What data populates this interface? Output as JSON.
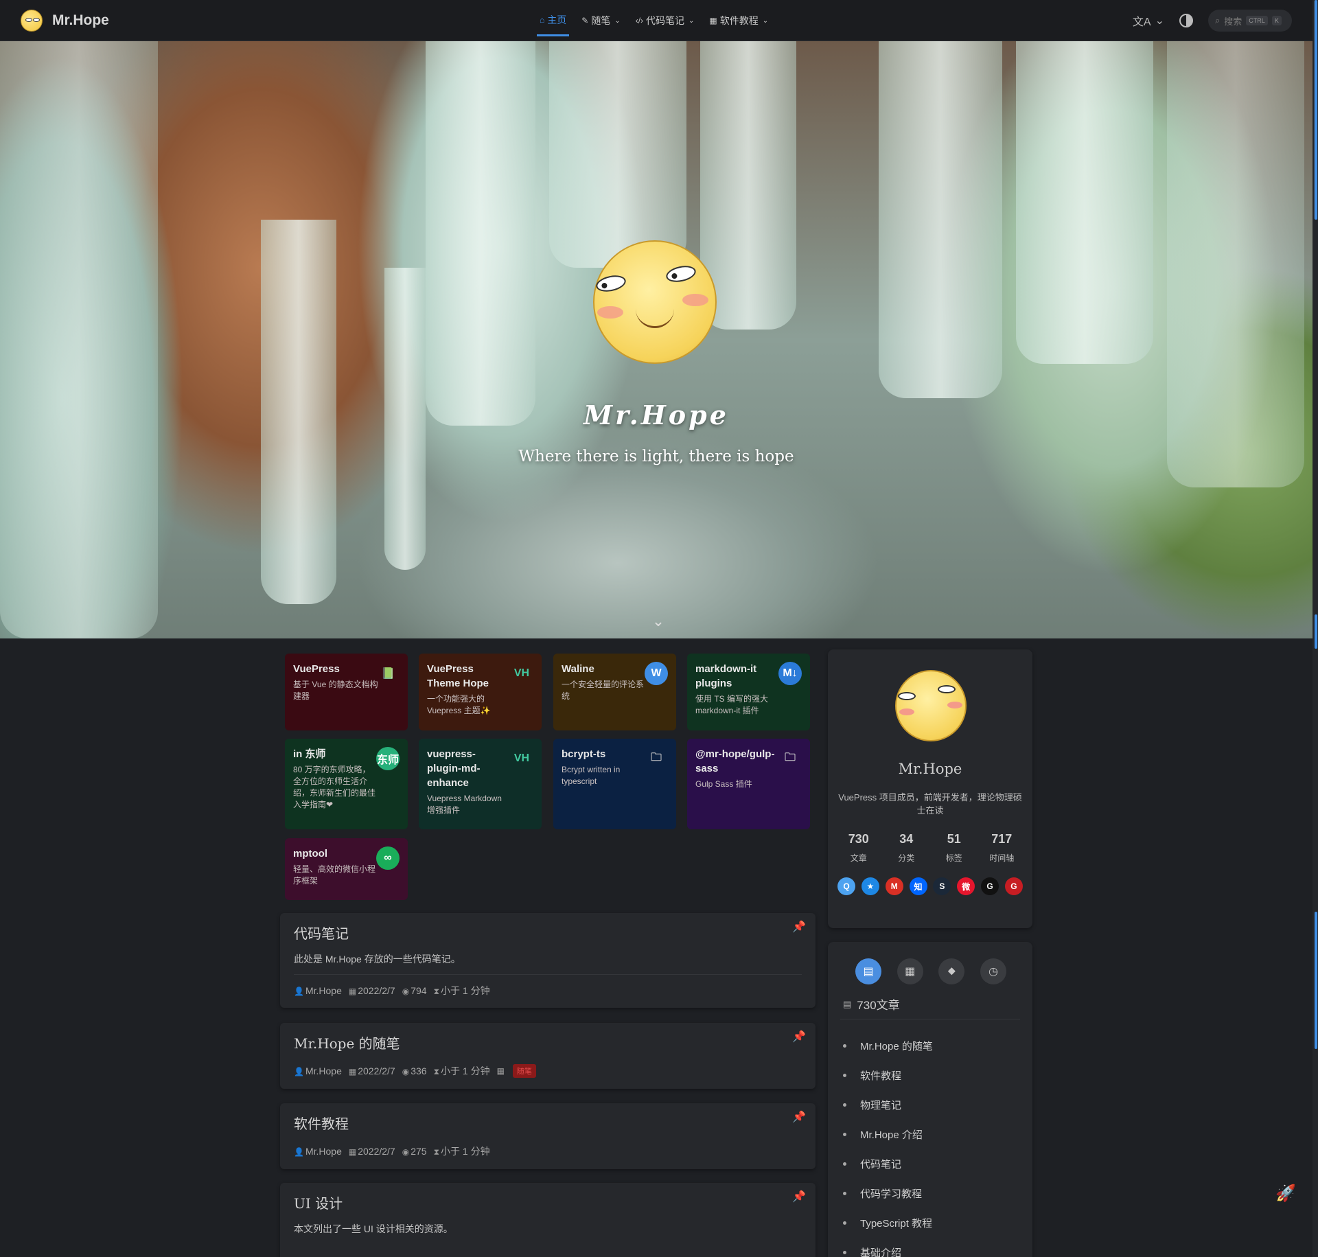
{
  "navbar": {
    "brand": "Mr.Hope",
    "links": [
      {
        "icon": "⌂",
        "label": "主页",
        "active": true,
        "dropdown": false
      },
      {
        "icon": "✎",
        "label": "随笔",
        "active": false,
        "dropdown": true
      },
      {
        "icon": "‹/›",
        "label": "代码笔记",
        "active": false,
        "dropdown": true
      },
      {
        "icon": "▦",
        "label": "软件教程",
        "active": false,
        "dropdown": true
      }
    ],
    "search_placeholder": "搜索",
    "search_key_ctrl": "CTRL",
    "search_key_k": "K"
  },
  "hero": {
    "title": "Mr.Hope",
    "tagline": "Where there is light, there is hope"
  },
  "projects": [
    {
      "name": "VuePress",
      "desc": "基于 Vue 的静态文档构建器",
      "bg": "#3a0a12",
      "icon_name": "vuepress-book-icon",
      "icon_glyph": "📗",
      "icon_bg": "transparent",
      "icon_color": "#4fc08d"
    },
    {
      "name": "VuePress Theme Hope",
      "desc": "一个功能强大的 Vuepress 主题✨",
      "bg": "#3d1a0e",
      "icon_name": "vuepress-theme-hope-icon",
      "icon_glyph": "VH",
      "icon_bg": "transparent",
      "icon_color": "#42c9a0"
    },
    {
      "name": "Waline",
      "desc": "一个安全轻量的评论系统",
      "bg": "#3a280a",
      "icon_name": "waline-icon",
      "icon_glyph": "W",
      "icon_bg": "#3f8ee5",
      "icon_color": "#ffffff"
    },
    {
      "name": "markdown-it plugins",
      "desc": "使用 TS 编写的强大 markdown-it 插件",
      "bg": "#0f3320",
      "icon_name": "markdown-icon",
      "icon_glyph": "M↓",
      "icon_bg": "#2b7bd8",
      "icon_color": "#ffffff"
    },
    {
      "name": "in 东师",
      "desc": "80 万字的东师攻略，全方位的东师生活介绍，东师新生们的最佳入学指南❤",
      "bg": "#0e3320",
      "icon_name": "in-dongshi-icon",
      "icon_glyph": "东师",
      "icon_bg": "#27b07a",
      "icon_color": "#ffffff"
    },
    {
      "name": "vuepress-plugin-md-enhance",
      "desc": "Vuepress Markdown 增强插件",
      "bg": "#0e2e28",
      "icon_name": "vuepress-theme-hope-icon",
      "icon_glyph": "VH",
      "icon_bg": "transparent",
      "icon_color": "#42c9a0"
    },
    {
      "name": "bcrypt-ts",
      "desc": "Bcrypt written in typescript",
      "bg": "#0b2142",
      "icon_name": "folder-icon",
      "icon_glyph": "🗀",
      "icon_bg": "transparent",
      "icon_color": "#cccccc"
    },
    {
      "name": "@mr-hope/gulp-sass",
      "desc": "Gulp Sass 插件",
      "bg": "#2a0f4a",
      "icon_name": "folder-icon",
      "icon_glyph": "🗀",
      "icon_bg": "transparent",
      "icon_color": "#cccccc"
    },
    {
      "name": "mptool",
      "desc": "轻量、高效的微信小程序框架",
      "bg": "#3d0e2c",
      "icon_name": "mini-program-icon",
      "icon_glyph": "∞",
      "icon_bg": "#1aad5a",
      "icon_color": "#ffffff"
    }
  ],
  "articles": [
    {
      "title": "代码笔记",
      "excerpt": "此处是 Mr.Hope 存放的一些代码笔记。",
      "author": "Mr.Hope",
      "date": "2022/2/7",
      "views": "794",
      "reading": "小于 1 分钟",
      "tag": ""
    },
    {
      "title": "Mr.Hope 的随笔",
      "excerpt": "",
      "author": "Mr.Hope",
      "date": "2022/2/7",
      "views": "336",
      "reading": "小于 1 分钟",
      "tag": "随笔"
    },
    {
      "title": "软件教程",
      "excerpt": "",
      "author": "Mr.Hope",
      "date": "2022/2/7",
      "views": "275",
      "reading": "小于 1 分钟",
      "tag": ""
    },
    {
      "title": "UI 设计",
      "excerpt": "本文列出了一些 UI 设计相关的资源。",
      "author": "",
      "date": "",
      "views": "",
      "reading": "",
      "tag": ""
    }
  ],
  "blogger": {
    "name": "Mr.Hope",
    "description": "VuePress 项目成员，前端开发者，理论物理硕士在读",
    "stats": [
      {
        "num": "730",
        "label": "文章"
      },
      {
        "num": "34",
        "label": "分类"
      },
      {
        "num": "51",
        "label": "标签"
      },
      {
        "num": "717",
        "label": "时间轴"
      }
    ],
    "socials": [
      {
        "name": "qq-icon",
        "glyph": "Q",
        "bg": "#4da3f0"
      },
      {
        "name": "qzone-icon",
        "glyph": "★",
        "bg": "#1e88e5"
      },
      {
        "name": "gmail-icon",
        "glyph": "M",
        "bg": "#d93025"
      },
      {
        "name": "zhihu-icon",
        "glyph": "知",
        "bg": "#0066ff"
      },
      {
        "name": "steam-icon",
        "glyph": "S",
        "bg": "#1b2838"
      },
      {
        "name": "weibo-icon",
        "glyph": "微",
        "bg": "#e6162d"
      },
      {
        "name": "github-icon",
        "glyph": "G",
        "bg": "#111111"
      },
      {
        "name": "gitee-icon",
        "glyph": "G",
        "bg": "#c71d23"
      }
    ]
  },
  "info_panel": {
    "count_label": "730文章",
    "items": [
      "Mr.Hope 的随笔",
      "软件教程",
      "物理笔记",
      "Mr.Hope 介绍",
      "代码笔记",
      "代码学习教程",
      "TypeScript 教程",
      "基础介绍"
    ]
  },
  "colors": {
    "accent": "#3f8ee5",
    "background": "#1e2024",
    "card": "#26282c"
  }
}
